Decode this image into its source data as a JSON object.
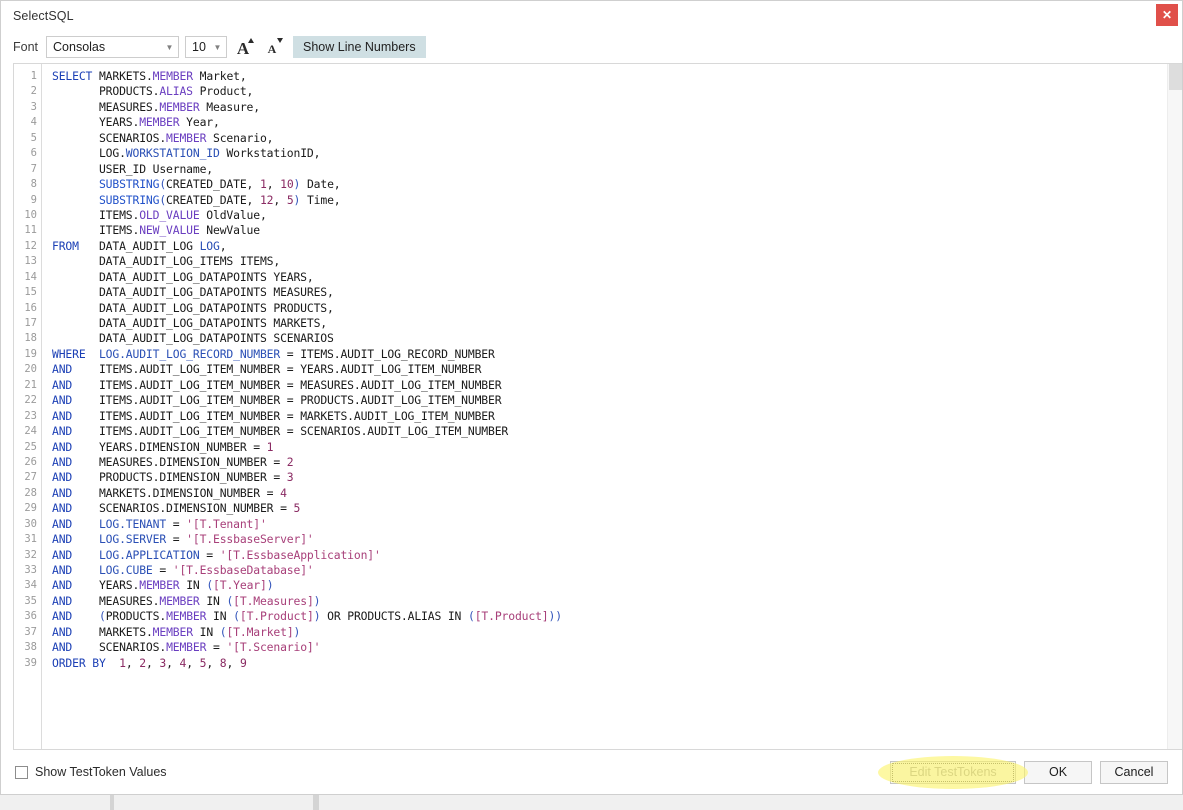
{
  "window": {
    "title": "SelectSQL",
    "close_label": "✕"
  },
  "toolbar": {
    "font_label": "Font",
    "font_value": "Consolas",
    "font_size_value": "10",
    "increase_font_glyph": "A",
    "decrease_font_glyph": "A",
    "show_line_numbers_label": "Show Line Numbers",
    "dropdown_glyph": "▼",
    "active_toggle_color": "#cfdfe3"
  },
  "footer": {
    "checkbox_label": "Show TestToken Values",
    "checkbox_checked": false,
    "edit_testtokens_label": "Edit TestTokens",
    "ok_label": "OK",
    "cancel_label": "Cancel",
    "annotation_color": "#fbf36a"
  },
  "editor": {
    "line_numbers": [
      1,
      2,
      3,
      4,
      5,
      6,
      7,
      8,
      9,
      10,
      11,
      12,
      13,
      14,
      15,
      16,
      17,
      18,
      19,
      20,
      21,
      22,
      23,
      24,
      25,
      26,
      27,
      28,
      29,
      30,
      31,
      32,
      33,
      34,
      35,
      36,
      37,
      38,
      39
    ],
    "syntax_colors": {
      "keyword": "#1b3fb5",
      "function": "#2151c9",
      "property": "#6a3ec0",
      "string": "#a8407a",
      "number": "#8a2b63",
      "identifier": "#1a1a1a",
      "gutter": "#9a9a9a"
    },
    "lines": [
      [
        {
          "t": "SELECT ",
          "c": "kw"
        },
        {
          "t": "MARKETS",
          "c": "id"
        },
        {
          "t": ".",
          "c": "id"
        },
        {
          "t": "MEMBER",
          "c": "prop"
        },
        {
          "t": " Market,",
          "c": "id"
        }
      ],
      [
        {
          "t": "       PRODUCTS",
          "c": "id"
        },
        {
          "t": ".",
          "c": "id"
        },
        {
          "t": "ALIAS",
          "c": "prop"
        },
        {
          "t": " Product,",
          "c": "id"
        }
      ],
      [
        {
          "t": "       MEASURES",
          "c": "id"
        },
        {
          "t": ".",
          "c": "id"
        },
        {
          "t": "MEMBER",
          "c": "prop"
        },
        {
          "t": " Measure,",
          "c": "id"
        }
      ],
      [
        {
          "t": "       YEARS",
          "c": "id"
        },
        {
          "t": ".",
          "c": "id"
        },
        {
          "t": "MEMBER",
          "c": "prop"
        },
        {
          "t": " Year,",
          "c": "id"
        }
      ],
      [
        {
          "t": "       SCENARIOS",
          "c": "id"
        },
        {
          "t": ".",
          "c": "id"
        },
        {
          "t": "MEMBER",
          "c": "prop"
        },
        {
          "t": " Scenario,",
          "c": "id"
        }
      ],
      [
        {
          "t": "       LOG",
          "c": "id"
        },
        {
          "t": ".",
          "c": "id"
        },
        {
          "t": "WORKSTATION_ID",
          "c": "tbl"
        },
        {
          "t": " WorkstationID,",
          "c": "id"
        }
      ],
      [
        {
          "t": "       USER_ID Username,",
          "c": "id"
        }
      ],
      [
        {
          "t": "       SUBSTRING",
          "c": "fn"
        },
        {
          "t": "(",
          "c": "pun"
        },
        {
          "t": "CREATED_DATE, ",
          "c": "id"
        },
        {
          "t": "1",
          "c": "num"
        },
        {
          "t": ", ",
          "c": "id"
        },
        {
          "t": "10",
          "c": "num"
        },
        {
          "t": ")",
          "c": "pun"
        },
        {
          "t": " Date,",
          "c": "id"
        }
      ],
      [
        {
          "t": "       SUBSTRING",
          "c": "fn"
        },
        {
          "t": "(",
          "c": "pun"
        },
        {
          "t": "CREATED_DATE, ",
          "c": "id"
        },
        {
          "t": "12",
          "c": "num"
        },
        {
          "t": ", ",
          "c": "id"
        },
        {
          "t": "5",
          "c": "num"
        },
        {
          "t": ")",
          "c": "pun"
        },
        {
          "t": " Time,",
          "c": "id"
        }
      ],
      [
        {
          "t": "       ITEMS",
          "c": "id"
        },
        {
          "t": ".",
          "c": "id"
        },
        {
          "t": "OLD_VALUE",
          "c": "prop"
        },
        {
          "t": " OldValue,",
          "c": "id"
        }
      ],
      [
        {
          "t": "       ITEMS",
          "c": "id"
        },
        {
          "t": ".",
          "c": "id"
        },
        {
          "t": "NEW_VALUE",
          "c": "prop"
        },
        {
          "t": " NewValue",
          "c": "id"
        }
      ],
      [
        {
          "t": "FROM   ",
          "c": "kw"
        },
        {
          "t": "DATA_AUDIT_LOG ",
          "c": "id"
        },
        {
          "t": "LOG",
          "c": "tbl"
        },
        {
          "t": ",",
          "c": "id"
        }
      ],
      [
        {
          "t": "       DATA_AUDIT_LOG_ITEMS ITEMS,",
          "c": "id"
        }
      ],
      [
        {
          "t": "       DATA_AUDIT_LOG_DATAPOINTS YEARS,",
          "c": "id"
        }
      ],
      [
        {
          "t": "       DATA_AUDIT_LOG_DATAPOINTS MEASURES,",
          "c": "id"
        }
      ],
      [
        {
          "t": "       DATA_AUDIT_LOG_DATAPOINTS PRODUCTS,",
          "c": "id"
        }
      ],
      [
        {
          "t": "       DATA_AUDIT_LOG_DATAPOINTS MARKETS,",
          "c": "id"
        }
      ],
      [
        {
          "t": "       DATA_AUDIT_LOG_DATAPOINTS SCENARIOS",
          "c": "id"
        }
      ],
      [
        {
          "t": "WHERE  ",
          "c": "kw"
        },
        {
          "t": "LOG.AUDIT_LOG_RECORD_NUMBER",
          "c": "tbl"
        },
        {
          "t": " = ITEMS.AUDIT_LOG_RECORD_NUMBER",
          "c": "id"
        }
      ],
      [
        {
          "t": "AND    ",
          "c": "kw"
        },
        {
          "t": "ITEMS.AUDIT_LOG_ITEM_NUMBER = YEARS.AUDIT_LOG_ITEM_NUMBER",
          "c": "id"
        }
      ],
      [
        {
          "t": "AND    ",
          "c": "kw"
        },
        {
          "t": "ITEMS.AUDIT_LOG_ITEM_NUMBER = MEASURES.AUDIT_LOG_ITEM_NUMBER",
          "c": "id"
        }
      ],
      [
        {
          "t": "AND    ",
          "c": "kw"
        },
        {
          "t": "ITEMS.AUDIT_LOG_ITEM_NUMBER = PRODUCTS.AUDIT_LOG_ITEM_NUMBER",
          "c": "id"
        }
      ],
      [
        {
          "t": "AND    ",
          "c": "kw"
        },
        {
          "t": "ITEMS.AUDIT_LOG_ITEM_NUMBER = MARKETS.AUDIT_LOG_ITEM_NUMBER",
          "c": "id"
        }
      ],
      [
        {
          "t": "AND    ",
          "c": "kw"
        },
        {
          "t": "ITEMS.AUDIT_LOG_ITEM_NUMBER = SCENARIOS.AUDIT_LOG_ITEM_NUMBER",
          "c": "id"
        }
      ],
      [
        {
          "t": "AND    ",
          "c": "kw"
        },
        {
          "t": "YEARS.DIMENSION_NUMBER = ",
          "c": "id"
        },
        {
          "t": "1",
          "c": "num"
        }
      ],
      [
        {
          "t": "AND    ",
          "c": "kw"
        },
        {
          "t": "MEASURES.DIMENSION_NUMBER = ",
          "c": "id"
        },
        {
          "t": "2",
          "c": "num"
        }
      ],
      [
        {
          "t": "AND    ",
          "c": "kw"
        },
        {
          "t": "PRODUCTS.DIMENSION_NUMBER = ",
          "c": "id"
        },
        {
          "t": "3",
          "c": "num"
        }
      ],
      [
        {
          "t": "AND    ",
          "c": "kw"
        },
        {
          "t": "MARKETS.DIMENSION_NUMBER = ",
          "c": "id"
        },
        {
          "t": "4",
          "c": "num"
        }
      ],
      [
        {
          "t": "AND    ",
          "c": "kw"
        },
        {
          "t": "SCENARIOS.DIMENSION_NUMBER = ",
          "c": "id"
        },
        {
          "t": "5",
          "c": "num"
        }
      ],
      [
        {
          "t": "AND    ",
          "c": "kw"
        },
        {
          "t": "LOG.TENANT",
          "c": "tbl"
        },
        {
          "t": " = ",
          "c": "id"
        },
        {
          "t": "'[T.Tenant]'",
          "c": "str"
        }
      ],
      [
        {
          "t": "AND    ",
          "c": "kw"
        },
        {
          "t": "LOG.SERVER",
          "c": "tbl"
        },
        {
          "t": " = ",
          "c": "id"
        },
        {
          "t": "'[T.EssbaseServer]'",
          "c": "str"
        }
      ],
      [
        {
          "t": "AND    ",
          "c": "kw"
        },
        {
          "t": "LOG.APPLICATION",
          "c": "tbl"
        },
        {
          "t": " = ",
          "c": "id"
        },
        {
          "t": "'[T.EssbaseApplication]'",
          "c": "str"
        }
      ],
      [
        {
          "t": "AND    ",
          "c": "kw"
        },
        {
          "t": "LOG.CUBE",
          "c": "tbl"
        },
        {
          "t": " = ",
          "c": "id"
        },
        {
          "t": "'[T.EssbaseDatabase]'",
          "c": "str"
        }
      ],
      [
        {
          "t": "AND    ",
          "c": "kw"
        },
        {
          "t": "YEARS",
          "c": "id"
        },
        {
          "t": ".",
          "c": "id"
        },
        {
          "t": "MEMBER",
          "c": "prop"
        },
        {
          "t": " IN ",
          "c": "id"
        },
        {
          "t": "(",
          "c": "pun"
        },
        {
          "t": "[T.Year]",
          "c": "str"
        },
        {
          "t": ")",
          "c": "pun"
        }
      ],
      [
        {
          "t": "AND    ",
          "c": "kw"
        },
        {
          "t": "MEASURES",
          "c": "id"
        },
        {
          "t": ".",
          "c": "id"
        },
        {
          "t": "MEMBER",
          "c": "prop"
        },
        {
          "t": " IN ",
          "c": "id"
        },
        {
          "t": "(",
          "c": "pun"
        },
        {
          "t": "[T.Measures]",
          "c": "str"
        },
        {
          "t": ")",
          "c": "pun"
        }
      ],
      [
        {
          "t": "AND    ",
          "c": "kw"
        },
        {
          "t": "(",
          "c": "pun"
        },
        {
          "t": "PRODUCTS",
          "c": "id"
        },
        {
          "t": ".",
          "c": "id"
        },
        {
          "t": "MEMBER",
          "c": "prop"
        },
        {
          "t": " IN ",
          "c": "id"
        },
        {
          "t": "(",
          "c": "pun"
        },
        {
          "t": "[T.Product]",
          "c": "str"
        },
        {
          "t": ")",
          "c": "pun"
        },
        {
          "t": " OR PRODUCTS.ALIAS IN ",
          "c": "id"
        },
        {
          "t": "(",
          "c": "pun"
        },
        {
          "t": "[T.Product]",
          "c": "str"
        },
        {
          "t": "))",
          "c": "pun"
        }
      ],
      [
        {
          "t": "AND    ",
          "c": "kw"
        },
        {
          "t": "MARKETS",
          "c": "id"
        },
        {
          "t": ".",
          "c": "id"
        },
        {
          "t": "MEMBER",
          "c": "prop"
        },
        {
          "t": " IN ",
          "c": "id"
        },
        {
          "t": "(",
          "c": "pun"
        },
        {
          "t": "[T.Market]",
          "c": "str"
        },
        {
          "t": ")",
          "c": "pun"
        }
      ],
      [
        {
          "t": "AND    ",
          "c": "kw"
        },
        {
          "t": "SCENARIOS",
          "c": "id"
        },
        {
          "t": ".",
          "c": "id"
        },
        {
          "t": "MEMBER",
          "c": "prop"
        },
        {
          "t": " = ",
          "c": "id"
        },
        {
          "t": "'[T.Scenario]'",
          "c": "str"
        }
      ],
      [
        {
          "t": "ORDER BY ",
          "c": "kw"
        },
        {
          "t": " ",
          "c": "id"
        },
        {
          "t": "1",
          "c": "num"
        },
        {
          "t": ", ",
          "c": "id"
        },
        {
          "t": "2",
          "c": "num"
        },
        {
          "t": ", ",
          "c": "id"
        },
        {
          "t": "3",
          "c": "num"
        },
        {
          "t": ", ",
          "c": "id"
        },
        {
          "t": "4",
          "c": "num"
        },
        {
          "t": ", ",
          "c": "id"
        },
        {
          "t": "5",
          "c": "num"
        },
        {
          "t": ", ",
          "c": "id"
        },
        {
          "t": "8",
          "c": "num"
        },
        {
          "t": ", ",
          "c": "id"
        },
        {
          "t": "9",
          "c": "num"
        }
      ]
    ]
  }
}
